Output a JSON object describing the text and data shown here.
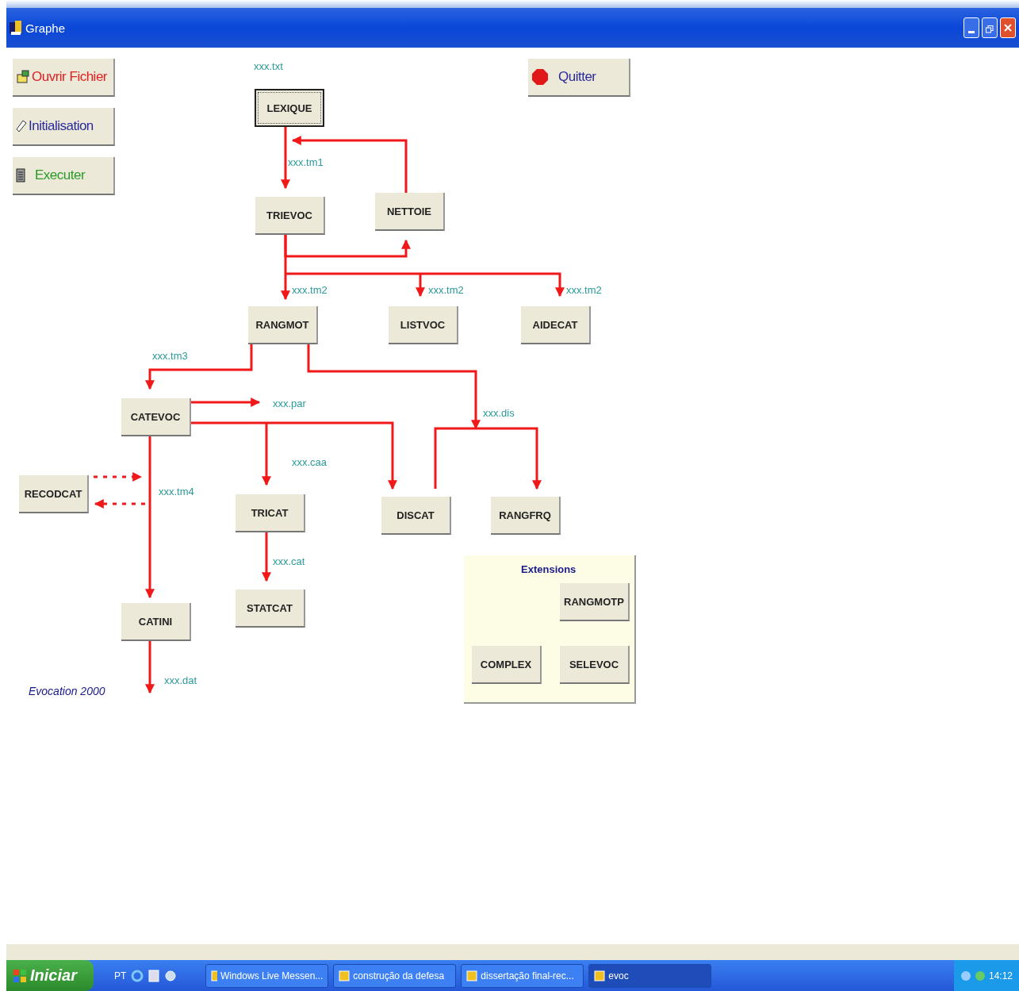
{
  "window": {
    "title": "Graphe"
  },
  "toolbar": [
    {
      "label": "Ouvrir Fichier",
      "kind": "open"
    },
    {
      "label": "Initialisation",
      "kind": "init"
    },
    {
      "label": "Executer",
      "kind": "run"
    },
    {
      "label": "Quitter",
      "kind": "quit"
    }
  ],
  "diagram": {
    "nodes": [
      {
        "label": "LEXIQUE",
        "focused": true
      },
      {
        "label": "TRIEVOC",
        "focused": false
      },
      {
        "label": "NETTOIE",
        "focused": false
      },
      {
        "label": "RANGMOT",
        "focused": false
      },
      {
        "label": "LISTVOC",
        "focused": false
      },
      {
        "label": "AIDECAT",
        "focused": false
      },
      {
        "label": "CATEVOC",
        "focused": false
      },
      {
        "label": "RECODCAT",
        "focused": false
      },
      {
        "label": "TRICAT",
        "focused": false
      },
      {
        "label": "DISCAT",
        "focused": false
      },
      {
        "label": "RANGFRQ",
        "focused": false
      },
      {
        "label": "CATINI",
        "focused": false
      },
      {
        "label": "STATCAT",
        "focused": false
      }
    ],
    "file_labels": [
      "xxx.txt",
      "xxx.tm1",
      "xxx.tm2",
      "xxx.tm2",
      "xxx.tm2",
      "xxx.tm3",
      "xxx.par",
      "xxx.dis",
      "xxx.caa",
      "xxx.tm4",
      "xxx.cat",
      "xxx.dat"
    ],
    "extensions": {
      "title": "Extensions",
      "nodes": [
        {
          "label": "RANGMOTP",
          "focused": false
        },
        {
          "label": "COMPLEX",
          "focused": false
        },
        {
          "label": "SELEVOC",
          "focused": false
        }
      ]
    }
  },
  "signature": "Evocation 2000",
  "taskbar": {
    "start": "Iniciar",
    "language": "PT",
    "tasks": [
      {
        "label": "Windows Live Messen...",
        "selected": false
      },
      {
        "label": "construção da defesa",
        "selected": false
      },
      {
        "label": "dissertação final-rec...",
        "selected": false
      },
      {
        "label": "evoc",
        "selected": true
      }
    ],
    "clock": "14:12"
  }
}
